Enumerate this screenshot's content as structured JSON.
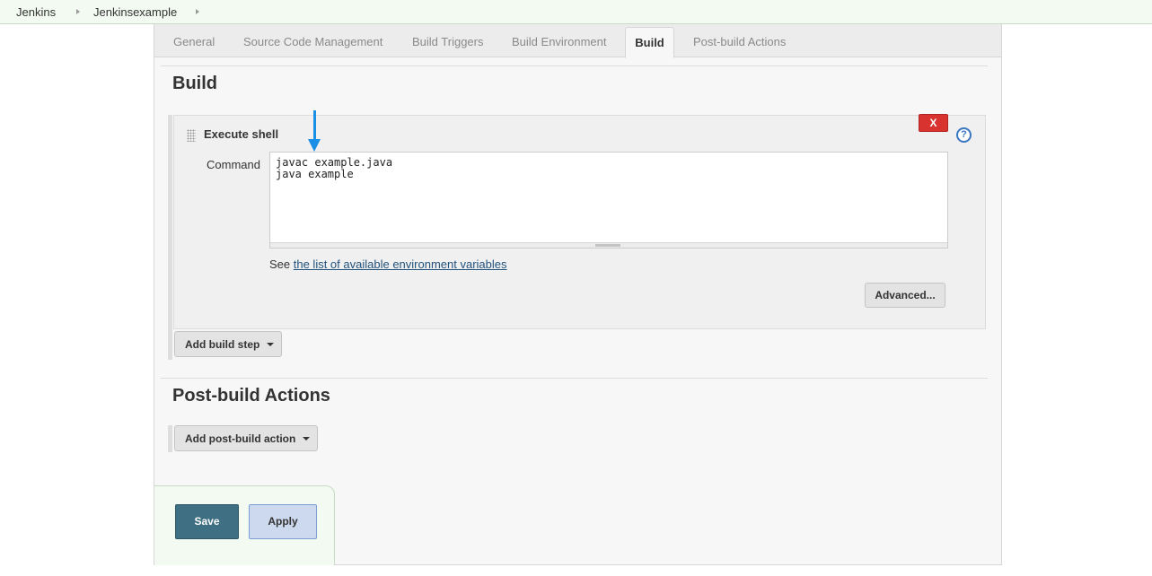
{
  "breadcrumb": {
    "items": [
      "Jenkins",
      "Jenkinsexample"
    ]
  },
  "tabs": [
    {
      "label": "General",
      "active": false
    },
    {
      "label": "Source Code Management",
      "active": false
    },
    {
      "label": "Build Triggers",
      "active": false
    },
    {
      "label": "Build Environment",
      "active": false
    },
    {
      "label": "Build",
      "active": true
    },
    {
      "label": "Post-build Actions",
      "active": false
    }
  ],
  "build_section": {
    "title": "Build",
    "step": {
      "title": "Execute shell",
      "delete_label": "X",
      "help_label": "?",
      "command_label": "Command",
      "command_value": "javac example.java\njava example",
      "env_prefix": "See ",
      "env_link": "the list of available environment variables",
      "advanced_label": "Advanced..."
    },
    "add_step_label": "Add build step"
  },
  "post_build_section": {
    "title": "Post-build Actions",
    "add_action_label": "Add post-build action"
  },
  "bottom": {
    "save_label": "Save",
    "apply_label": "Apply"
  },
  "colors": {
    "breadcrumb_bg": "#f3faf2",
    "delete_red": "#d9332f",
    "save_blue": "#3f6f82",
    "apply_blue": "#cdd9ee",
    "annotation_arrow": "#1a8fe6",
    "link": "#23527c"
  }
}
